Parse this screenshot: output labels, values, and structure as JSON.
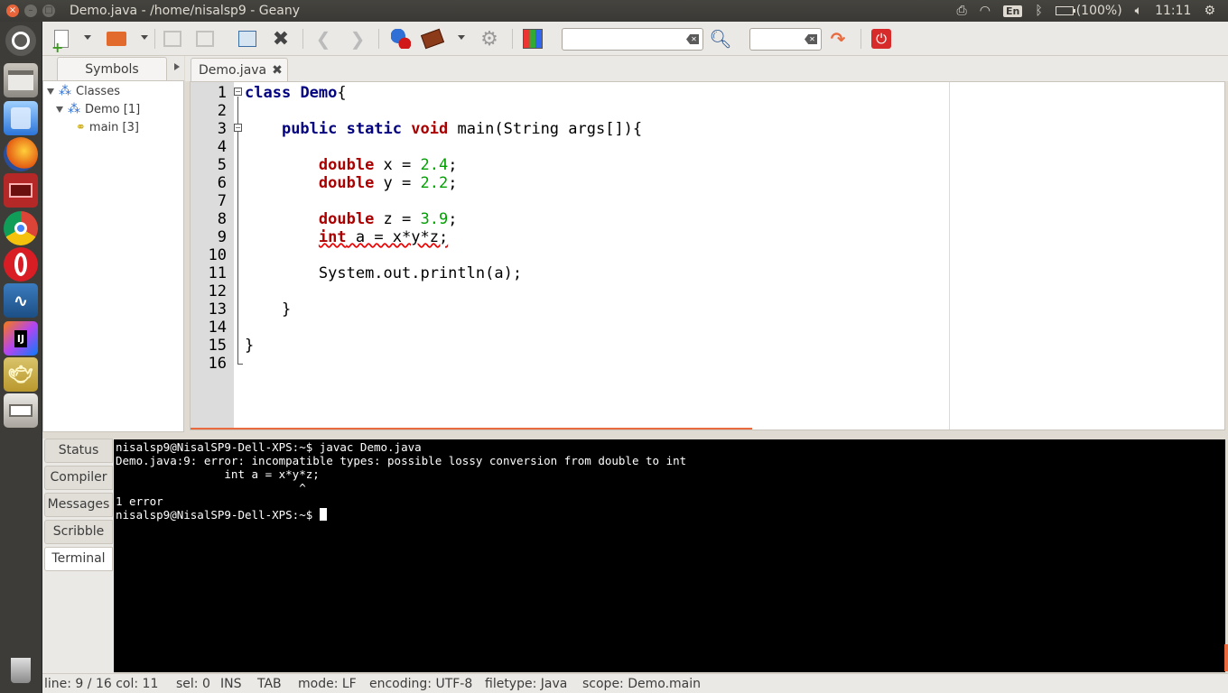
{
  "window": {
    "title": "Demo.java - /home/nisalsp9 - Geany"
  },
  "indicators": {
    "keyboard": "En",
    "battery": "(100%)",
    "clock": "11:11"
  },
  "launcher": {
    "items": [
      "dash-home-icon",
      "files-icon",
      "software-center-icon",
      "firefox-icon",
      "app-icon",
      "chrome-icon",
      "opera-icon",
      "mysql-workbench-icon",
      "intellij-icon",
      "geany-icon",
      "drive-icon",
      "trash-icon"
    ],
    "intellij_label": "IJ"
  },
  "toolbar": {
    "search_value": "",
    "goto_value": ""
  },
  "sidebar": {
    "tab_label": "Symbols",
    "tree": {
      "root": "Classes",
      "class_item": "Demo [1]",
      "method_item": "main [3]"
    }
  },
  "editor": {
    "tab_label": "Demo.java",
    "line_numbers": [
      "1",
      "2",
      "3",
      "4",
      "5",
      "6",
      "7",
      "8",
      "9",
      "10",
      "11",
      "12",
      "13",
      "14",
      "15",
      "16"
    ],
    "code": {
      "l1_kw": "class",
      "l1_name": "Demo",
      "l1_rest": "{",
      "l3_kw": "public static",
      "l3_type": "void",
      "l3_rest": " main(String args[]){",
      "l5_type": "double",
      "l5_rest": " x = ",
      "l5_num": "2.4",
      "l6_type": "double",
      "l6_rest": " y = ",
      "l6_num": "2.2",
      "l8_type": "double",
      "l8_rest": " z = ",
      "l8_num": "3.9",
      "l9_type": "int",
      "l9_rest": " a = x*y*z;",
      "l11": "System.out.println(a);",
      "l13": "}",
      "l15": "}",
      "semicolon": ";"
    }
  },
  "bottom_tabs": [
    "Status",
    "Compiler",
    "Messages",
    "Scribble",
    "Terminal"
  ],
  "terminal": {
    "line1": "nisalsp9@NisalSP9-Dell-XPS:~$ javac Demo.java",
    "line2": "Demo.java:9: error: incompatible types: possible lossy conversion from double to int",
    "line3": "                int a = x*y*z;",
    "line4": "                           ^",
    "line5": "1 error",
    "line6": "nisalsp9@NisalSP9-Dell-XPS:~$ "
  },
  "statusbar": {
    "line_col": "line: 9 / 16  col: 11",
    "sel": "sel: 0",
    "ins": "INS",
    "tab": "TAB",
    "mode": "mode: LF",
    "encoding": "encoding: UTF-8",
    "filetype": "filetype: Java",
    "scope": "scope: Demo.main"
  },
  "colors": {
    "accent": "#e96a3f",
    "keyword": "#000080",
    "type": "#aa0000",
    "number": "#00a000"
  }
}
